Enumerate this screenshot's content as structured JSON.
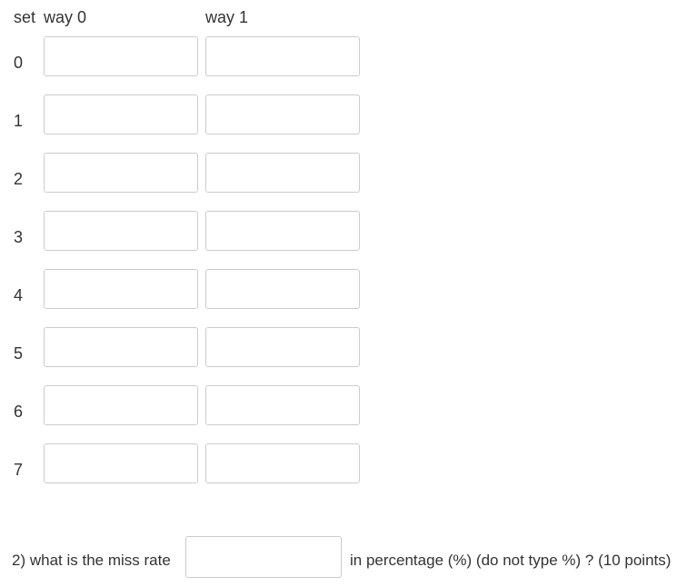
{
  "table": {
    "headers": {
      "set": "set",
      "way0": "way 0",
      "way1": "way 1"
    },
    "rows": [
      {
        "set": "0",
        "way0": "",
        "way1": ""
      },
      {
        "set": "1",
        "way0": "",
        "way1": ""
      },
      {
        "set": "2",
        "way0": "",
        "way1": ""
      },
      {
        "set": "3",
        "way0": "",
        "way1": ""
      },
      {
        "set": "4",
        "way0": "",
        "way1": ""
      },
      {
        "set": "5",
        "way0": "",
        "way1": ""
      },
      {
        "set": "6",
        "way0": "",
        "way1": ""
      },
      {
        "set": "7",
        "way0": "",
        "way1": ""
      }
    ]
  },
  "question2": {
    "prefix": "2) what is the miss rate",
    "value": "",
    "suffix": "in percentage (%) (do not type %) ?  (10 points)"
  }
}
